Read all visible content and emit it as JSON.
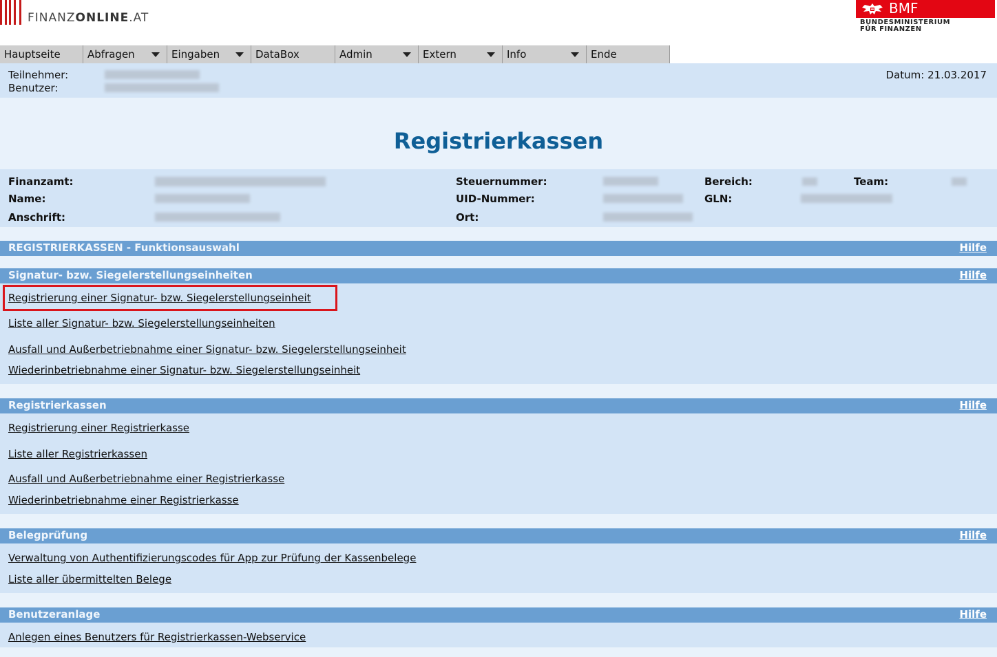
{
  "header": {
    "logo_text_prefix": "FINANZ",
    "logo_text_bold": "ONLINE",
    "logo_text_suffix": ".AT",
    "bmf_name": "BMF",
    "bmf_sub_line1": "BUNDESMINISTERIUM",
    "bmf_sub_line2": "FÜR FINANZEN",
    "brand_color": "#e30613"
  },
  "nav": [
    {
      "label": "Hauptseite",
      "has_dropdown": false
    },
    {
      "label": "Abfragen",
      "has_dropdown": true
    },
    {
      "label": "Eingaben",
      "has_dropdown": true
    },
    {
      "label": "DataBox",
      "has_dropdown": false
    },
    {
      "label": "Admin",
      "has_dropdown": true
    },
    {
      "label": "Extern",
      "has_dropdown": true
    },
    {
      "label": "Info",
      "has_dropdown": true
    },
    {
      "label": "Ende",
      "has_dropdown": false
    }
  ],
  "userbar": {
    "teilnehmer_label": "Teilnehmer:",
    "benutzer_label": "Benutzer:",
    "datum": "Datum: 21.03.2017"
  },
  "page_title": "Registrierkassen",
  "info": {
    "finanzamt_label": "Finanzamt:",
    "name_label": "Name:",
    "anschrift_label": "Anschrift:",
    "steuernummer_label": "Steuernummer:",
    "uid_label": "UID-Nummer:",
    "ort_label": "Ort:",
    "bereich_label": "Bereich:",
    "team_label": "Team:",
    "gln_label": "GLN:"
  },
  "sections": {
    "funktionsauswahl": {
      "title": "REGISTRIERKASSEN - Funktionsauswahl",
      "help": "Hilfe"
    },
    "signatur": {
      "title": "Signatur- bzw. Siegelerstellungseinheiten",
      "help": "Hilfe",
      "links": [
        "Registrierung einer Signatur- bzw. Siegelerstellungseinheit",
        "Liste aller Signatur- bzw. Siegelerstellungseinheiten",
        "Ausfall und Außerbetriebnahme einer Signatur- bzw. Siegelerstellungseinheit",
        "Wiederinbetriebnahme einer Signatur- bzw. Siegelerstellungseinheit"
      ]
    },
    "registrierkassen": {
      "title": "Registrierkassen",
      "help": "Hilfe",
      "links": [
        "Registrierung einer Registrierkasse",
        "Liste aller Registrierkassen",
        "Ausfall und Außerbetriebnahme einer Registrierkasse",
        "Wiederinbetriebnahme einer Registrierkasse"
      ]
    },
    "belegpruefung": {
      "title": "Belegprüfung",
      "help": "Hilfe",
      "links": [
        "Verwaltung von Authentifizierungscodes für App zur Prüfung der Kassenbelege",
        "Liste aller übermittelten Belege"
      ]
    },
    "benutzeranlage": {
      "title": "Benutzeranlage",
      "help": "Hilfe",
      "links": [
        "Anlegen eines Benutzers für Registrierkassen-Webservice"
      ]
    }
  }
}
